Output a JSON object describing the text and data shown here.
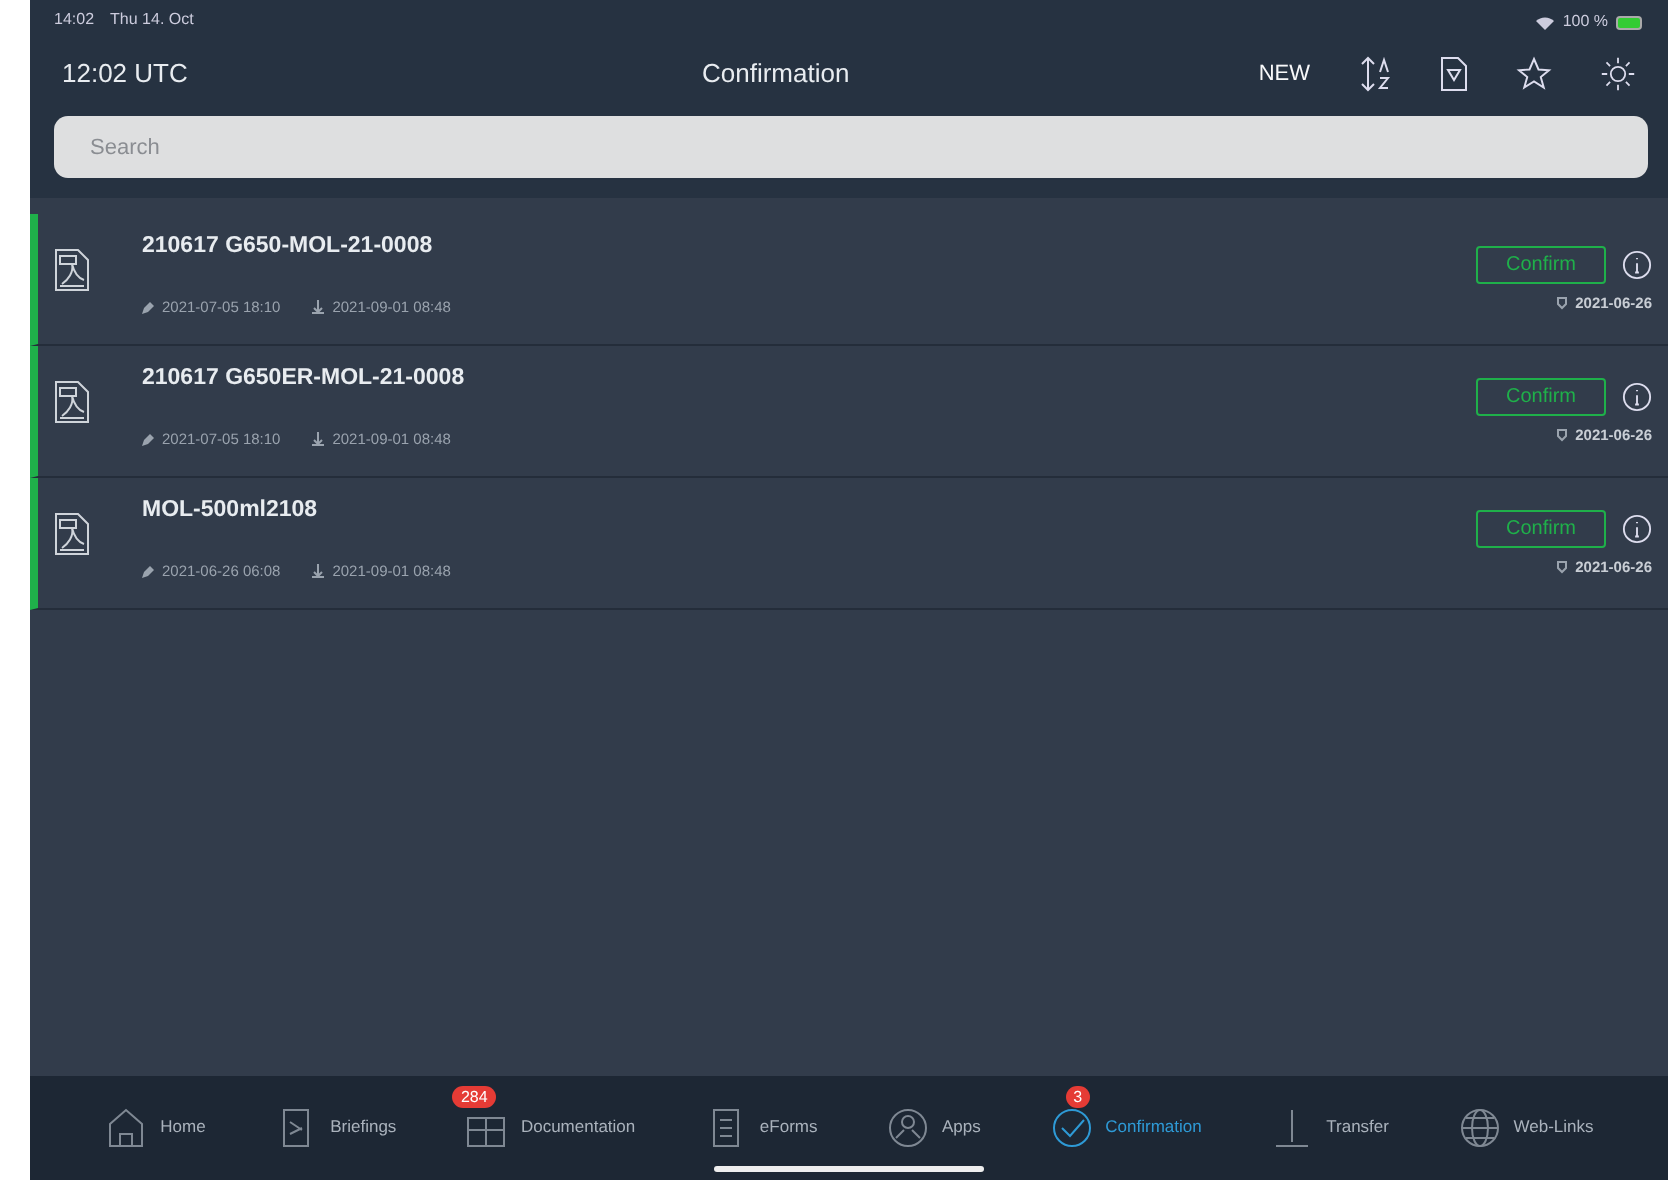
{
  "status_bar": {
    "time": "14:02",
    "date": "Thu 14. Oct",
    "battery": "100 %"
  },
  "header": {
    "clock": "12:02 UTC",
    "title": "Confirmation",
    "new_label": "NEW"
  },
  "search": {
    "placeholder": "Search"
  },
  "documents": [
    {
      "title": "210617 G650-MOL-21-0008",
      "edited": "2021-07-05 18:10",
      "downloaded": "2021-09-01 08:48",
      "button": "Confirm",
      "due": "2021-06-26"
    },
    {
      "title": "210617 G650ER-MOL-21-0008",
      "edited": "2021-07-05 18:10",
      "downloaded": "2021-09-01 08:48",
      "button": "Confirm",
      "due": "2021-06-26"
    },
    {
      "title": "MOL-500ml2108",
      "edited": "2021-06-26 06:08",
      "downloaded": "2021-09-01 08:48",
      "button": "Confirm",
      "due": "2021-06-26"
    }
  ],
  "tabs": [
    {
      "label": "Home",
      "selected": false
    },
    {
      "label": "Briefings",
      "selected": false
    },
    {
      "label": "Documentation",
      "selected": false,
      "badge": "284"
    },
    {
      "label": "eForms",
      "selected": false
    },
    {
      "label": "Apps",
      "selected": false
    },
    {
      "label": "Confirmation",
      "selected": true,
      "badge": "3"
    },
    {
      "label": "Transfer",
      "selected": false
    },
    {
      "label": "Web-Links",
      "selected": false
    }
  ]
}
